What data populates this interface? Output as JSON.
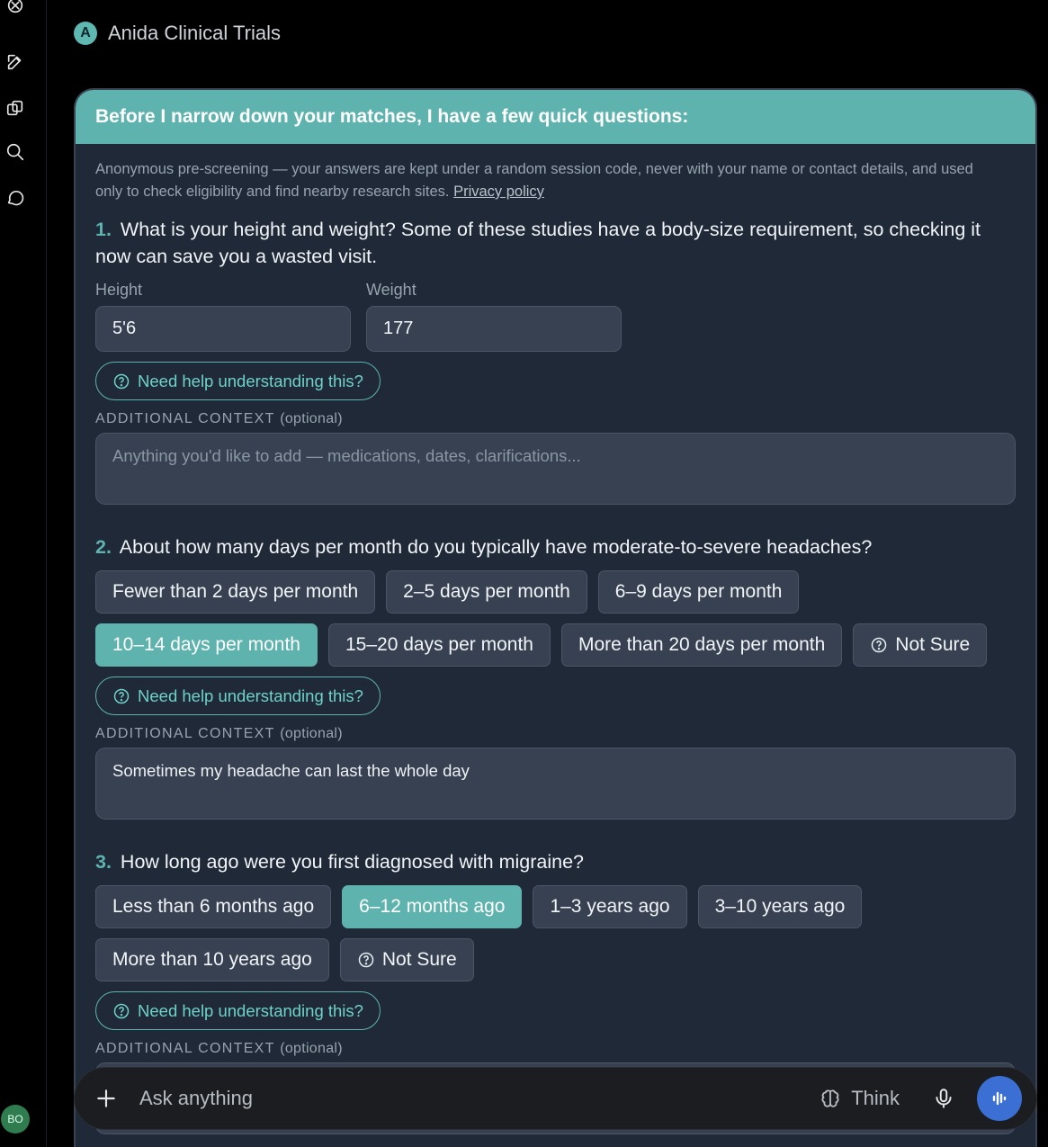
{
  "header": {
    "brand_initial": "A",
    "title": "Anida Clinical Trials"
  },
  "card": {
    "heading": "Before I narrow down your matches, I have a few quick questions:",
    "privacy_text": "Anonymous pre-screening — your answers are kept under a random session code, never with your name or contact details, and used only to check eligibility and find nearby research sites.",
    "privacy_link": "Privacy policy"
  },
  "help_label": "Need help understanding this?",
  "context_label": "ADDITIONAL CONTEXT",
  "context_optional": "(optional)",
  "context_placeholder": "Anything you'd like to add — medications, dates, clarifications...",
  "q1": {
    "num": "1.",
    "text": "What is your height and weight? Some of these studies have a body-size requirement, so checking it now can save you a wasted visit.",
    "height_label": "Height",
    "height_value": "5'6",
    "weight_label": "Weight",
    "weight_value": "177"
  },
  "q2": {
    "num": "2.",
    "text": "About how many days per month do you typically have moderate-to-severe headaches?",
    "options": [
      "Fewer than 2 days per month",
      "2–5 days per month",
      "6–9 days per month",
      "10–14 days per month",
      "15–20 days per month",
      "More than 20 days per month",
      "Not Sure"
    ],
    "selected": "10–14 days per month",
    "context_value": "Sometimes my headache can last the whole day"
  },
  "q3": {
    "num": "3.",
    "text": "How long ago were you first diagnosed with migraine?",
    "options": [
      "Less than 6 months ago",
      "6–12 months ago",
      "1–3 years ago",
      "3–10 years ago",
      "More than 10 years ago",
      "Not Sure"
    ],
    "selected": "6–12 months ago"
  },
  "composer": {
    "placeholder": "Ask anything",
    "think_label": "Think"
  },
  "user": {
    "initials": "BO"
  },
  "colors": {
    "accent": "#5eb3ae",
    "card_bg": "#1f2937",
    "voice": "#3b6fd4"
  }
}
